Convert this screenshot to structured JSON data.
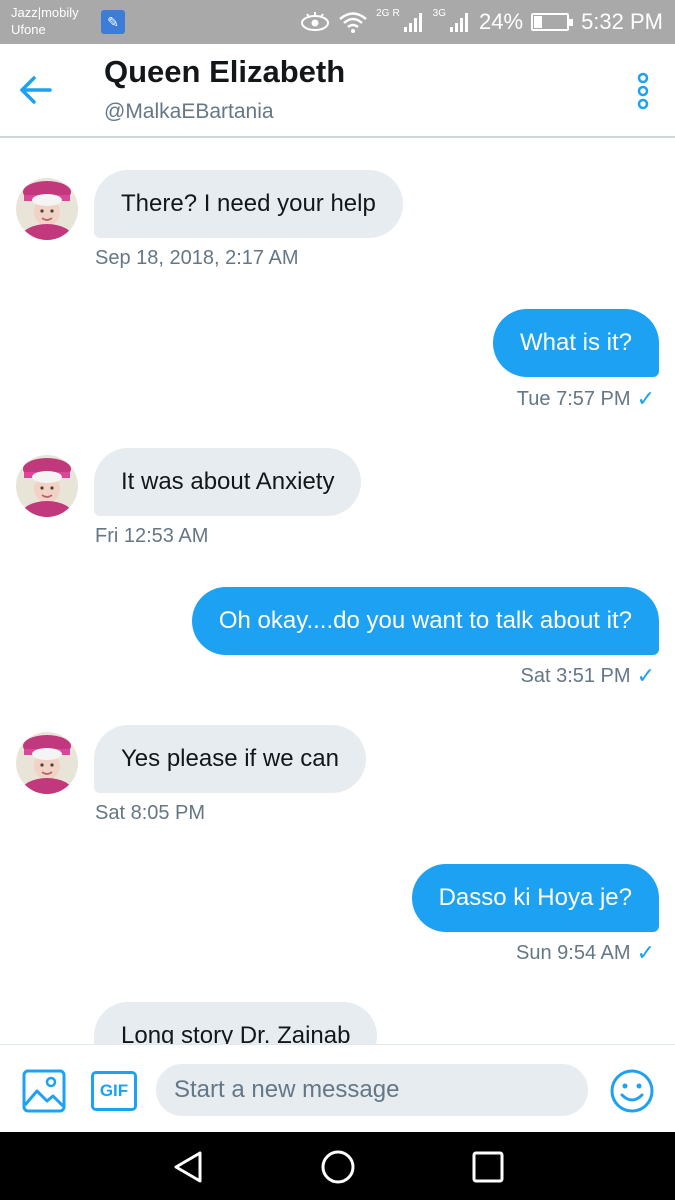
{
  "status_bar": {
    "carrier_line1": "Jazz|mobily",
    "carrier_line2": "Ufone",
    "net_2g": "2G",
    "net_r": "R",
    "net_3g": "3G",
    "battery": "24%",
    "battery_level": 0.24,
    "time": "5:32 PM"
  },
  "header": {
    "name": "Queen Elizabeth",
    "handle": "@MalkaEBartania"
  },
  "messages": [
    {
      "direction": "in",
      "text": "There? I need your help",
      "time": "Sep 18, 2018, 2:17 AM"
    },
    {
      "direction": "out",
      "text": "What is it?",
      "time": "Tue 7:57 PM",
      "read": "✓"
    },
    {
      "direction": "in",
      "text": "It was about Anxiety",
      "time": "Fri 12:53 AM"
    },
    {
      "direction": "out",
      "text": "Oh okay....do you want to talk about it?",
      "time": "Sat 3:51 PM",
      "read": "✓"
    },
    {
      "direction": "in",
      "text": "Yes please if we can",
      "time": "Sat 8:05 PM"
    },
    {
      "direction": "out",
      "text": "Dasso ki Hoya je?",
      "time": "Sun 9:54 AM",
      "read": "✓"
    },
    {
      "direction": "in",
      "text": "Long story Dr. Zainab",
      "time": ""
    }
  ],
  "composer": {
    "gif_label": "GIF",
    "placeholder": "Start a new message"
  },
  "icons": {
    "back": "arrow-left-icon",
    "more": "more-vertical-icon",
    "photo": "image-icon",
    "emoji": "smiley-icon",
    "nav_back": "triangle-back-icon",
    "nav_home": "circle-home-icon",
    "nav_recent": "square-recent-icon"
  },
  "colors": {
    "accent": "#1da1f2",
    "incoming_bubble": "#e6ecf0",
    "status_bar": "#a9a9a9",
    "secondary_text": "#657786"
  }
}
